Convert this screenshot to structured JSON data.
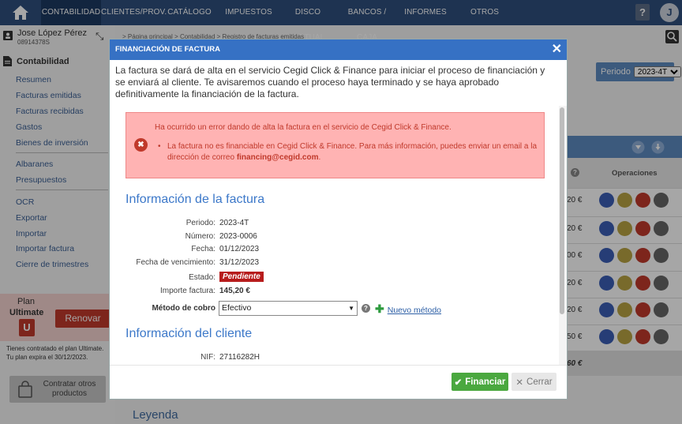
{
  "nav": {
    "items": [
      "CONTABILIDAD",
      "CLIENTES/PROV.",
      "CATÁLOGO",
      "IMPUESTOS",
      "DISCO VIRTUAL",
      "BANCOS / CAJA",
      "INFORMES",
      "OTROS"
    ],
    "help": "?",
    "avatar": "J"
  },
  "sidebar": {
    "user_name": "Jose López Pérez",
    "user_id": "08914378S",
    "section": "Contabilidad",
    "group1": [
      "Resumen",
      "Facturas emitidas",
      "Facturas recibidas",
      "Gastos",
      "Bienes de inversión"
    ],
    "group2": [
      "Albaranes",
      "Presupuestos"
    ],
    "group3": [
      "OCR",
      "Exportar",
      "Importar",
      "Importar factura",
      "Cierre de trimestres"
    ],
    "plan_label": "Plan",
    "plan_name": "Ultimate",
    "plan_badge": "U",
    "renew": "Renovar",
    "plan_note_1": "Tienes contratado el plan Ultimate.",
    "plan_note_2": "Tu plan expira el 30/12/2023.",
    "other_products": "Contratar otros productos"
  },
  "page": {
    "breadcrumb": "> Página principal > Contabilidad > Registro de facturas emitidas",
    "period_label": "Periodo",
    "period_value": "2023-4T",
    "ops_header": "Operaciones",
    "amounts": [
      "20 €",
      "20 €",
      "00 €",
      "20 €",
      "20 €",
      "50 €"
    ],
    "total": "60 €",
    "legend": "Leyenda"
  },
  "modal": {
    "title": "FINANCIACIÓN DE FACTURA",
    "intro": "La factura se dará de alta en el servicio Cegid Click & Finance para iniciar el proceso de financiación y se enviará al cliente. Te avisaremos cuando el proceso haya terminado y se haya aprobado definitivamente la financiación de la factura.",
    "error_title": "Ha ocurrido un error dando de alta la factura en el servicio de Cegid Click & Finance.",
    "error_msg": "La factura no es financiable en Cegid Click & Finance. Para más información, puedes enviar un email a la dirección de correo",
    "error_email": "financing@cegid.com",
    "invoice_title": "Información de la factura",
    "fields": [
      {
        "label": "Periodo:",
        "value": "2023-4T"
      },
      {
        "label": "Número:",
        "value": "2023-0006"
      },
      {
        "label": "Fecha:",
        "value": "01/12/2023"
      },
      {
        "label": "Fecha de vencimiento:",
        "value": "31/12/2023"
      }
    ],
    "status_label": "Estado:",
    "status_value": "Pendiente",
    "amount_label": "Importe factura:",
    "amount_value": "145,20 €",
    "method_label": "Método de cobro",
    "method_value": "Efectivo",
    "new_method": "Nuevo método",
    "client_title": "Información del cliente",
    "nif_label": "NIF:",
    "nif_value": "27116282H",
    "btn_financiar": "Financiar",
    "btn_cerrar": "Cerrar"
  },
  "colors": {
    "nav_bg": "#2e4f7d",
    "modal_header": "#3671c4",
    "error_bg": "#ffb3b3",
    "status_red": "#b71c1c",
    "financiar_green": "#4aa83f"
  }
}
